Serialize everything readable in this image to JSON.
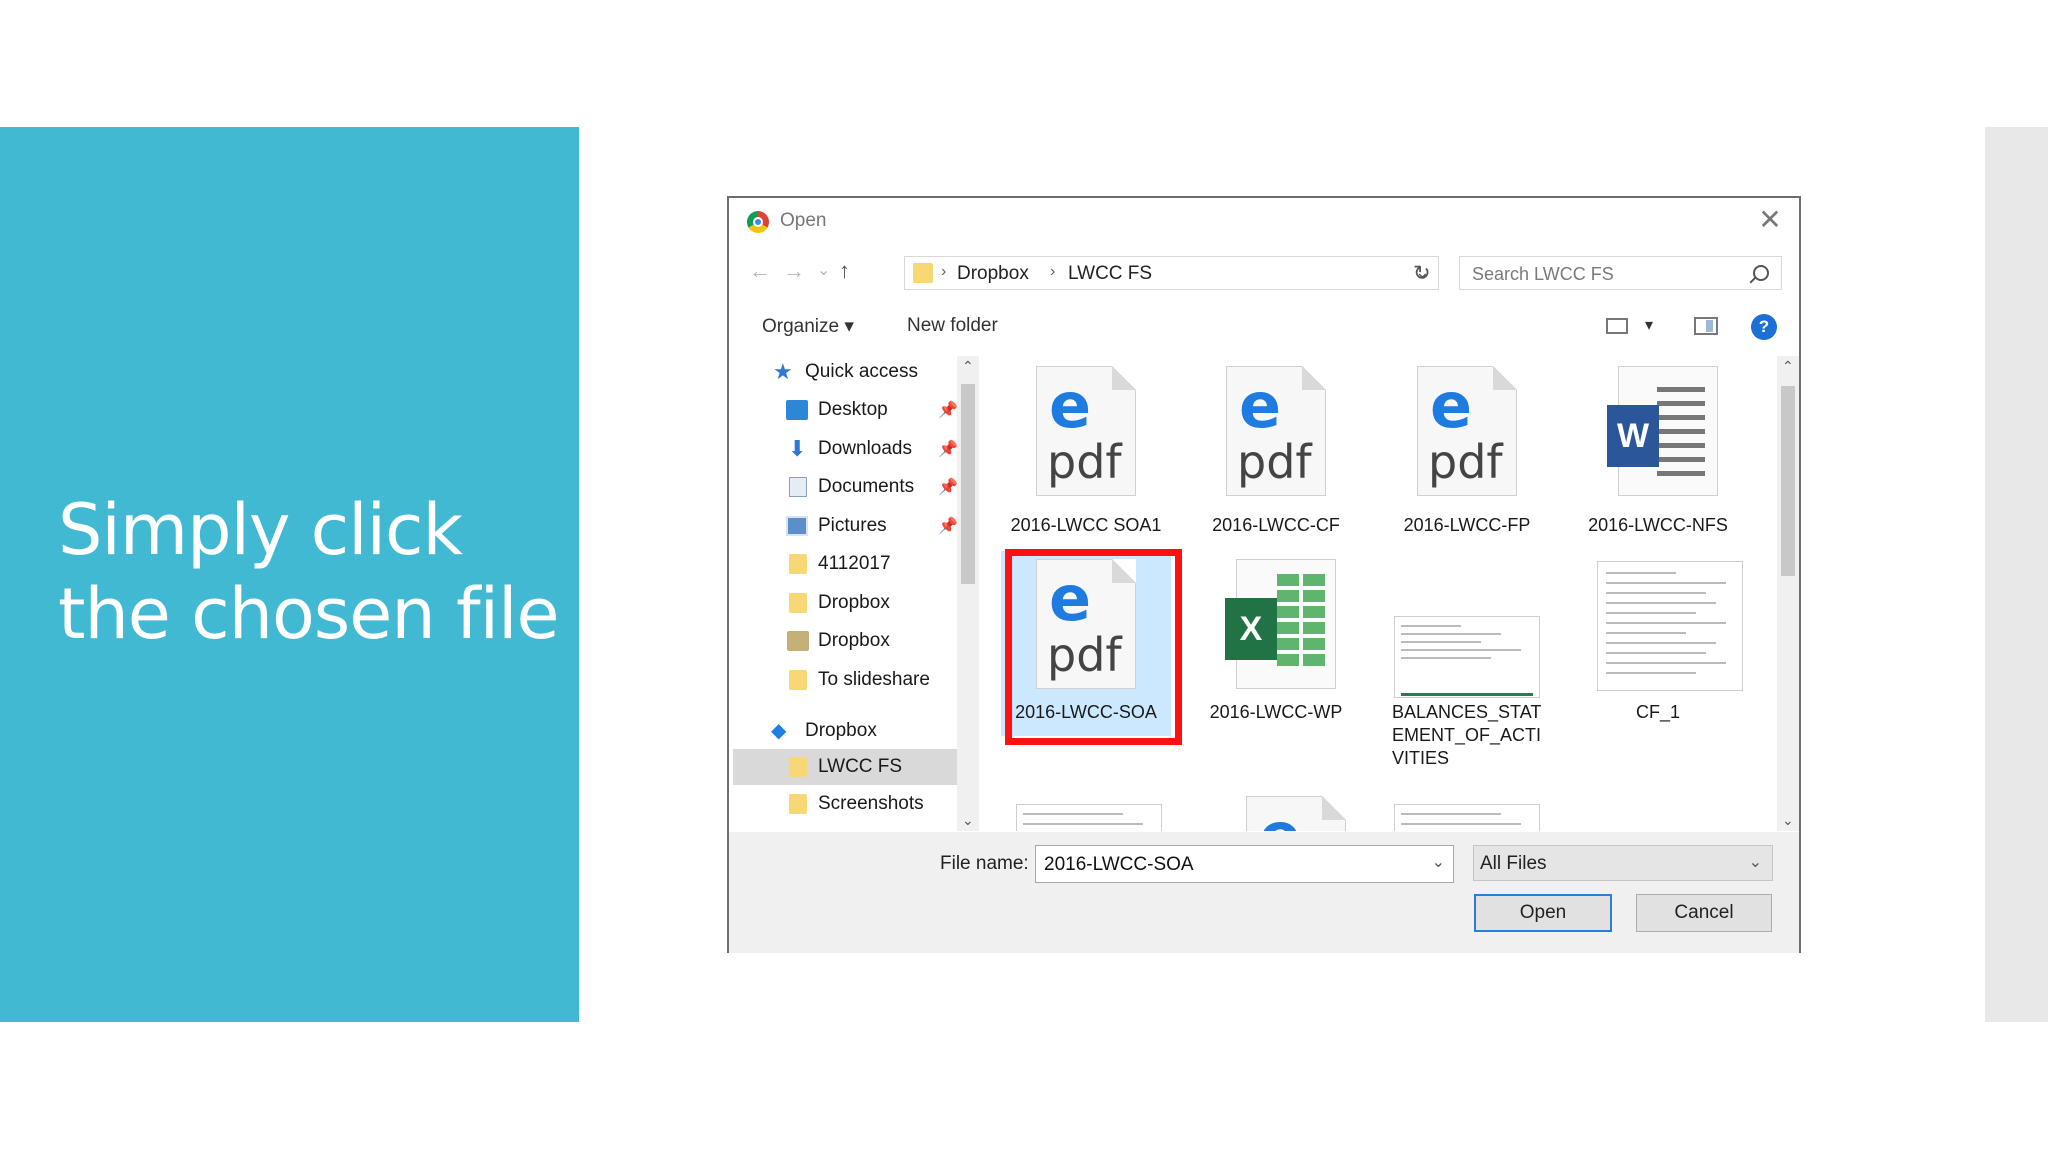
{
  "slide": {
    "line1": "Simply click",
    "line2": "the chosen file",
    "accent_color": "#42b9d3"
  },
  "dialog": {
    "title": "Open",
    "close_glyph": "✕",
    "nav": {
      "back": "←",
      "forward": "→",
      "recent": "⌄",
      "up": "↑"
    },
    "breadcrumb": [
      "Dropbox",
      "LWCC FS"
    ],
    "search_placeholder": "Search LWCC FS",
    "toolbar": {
      "organize": "Organize ▾",
      "new_folder": "New folder",
      "help": "?"
    },
    "nav_items": [
      {
        "label": "Quick access",
        "icon": "star-icon",
        "pinned": false
      },
      {
        "label": "Desktop",
        "icon": "desktop-icon",
        "pinned": true
      },
      {
        "label": "Downloads",
        "icon": "download-icon",
        "pinned": true
      },
      {
        "label": "Documents",
        "icon": "documents-icon",
        "pinned": true
      },
      {
        "label": "Pictures",
        "icon": "pictures-icon",
        "pinned": true
      },
      {
        "label": "4112017",
        "icon": "folder-icon",
        "pinned": false
      },
      {
        "label": "Dropbox",
        "icon": "folder-icon",
        "pinned": false
      },
      {
        "label": "Dropbox",
        "icon": "user-folder-icon",
        "pinned": false
      },
      {
        "label": "To slideshare",
        "icon": "folder-icon",
        "pinned": false
      },
      {
        "label": "Dropbox",
        "icon": "dropbox-icon",
        "pinned": false
      },
      {
        "label": "LWCC FS",
        "icon": "folder-icon",
        "pinned": false,
        "selected": true
      },
      {
        "label": "Screenshots",
        "icon": "folder-icon",
        "pinned": false
      }
    ],
    "files": [
      {
        "name": "2016-LWCC SOA1",
        "type": "pdf"
      },
      {
        "name": "2016-LWCC-CF",
        "type": "pdf"
      },
      {
        "name": "2016-LWCC-FP",
        "type": "pdf"
      },
      {
        "name": "2016-LWCC-NFS",
        "type": "word"
      },
      {
        "name": "2016-LWCC-SOA",
        "type": "pdf",
        "selected": true
      },
      {
        "name": "2016-LWCC-WP",
        "type": "excel"
      },
      {
        "name": "BALANCES_STAT EMENT_OF_ACTI VITIES",
        "type": "image"
      },
      {
        "name": "CF_1",
        "type": "image"
      }
    ],
    "pdf_e": "e",
    "pdf_word": "pdf",
    "word_letter": "W",
    "excel_letter": "X",
    "file_name_label": "File name:",
    "file_name_value": "2016-LWCC-SOA",
    "filter_value": "All Files",
    "open_button": "Open",
    "cancel_button": "Cancel",
    "highlight_color": "#ff1111"
  }
}
